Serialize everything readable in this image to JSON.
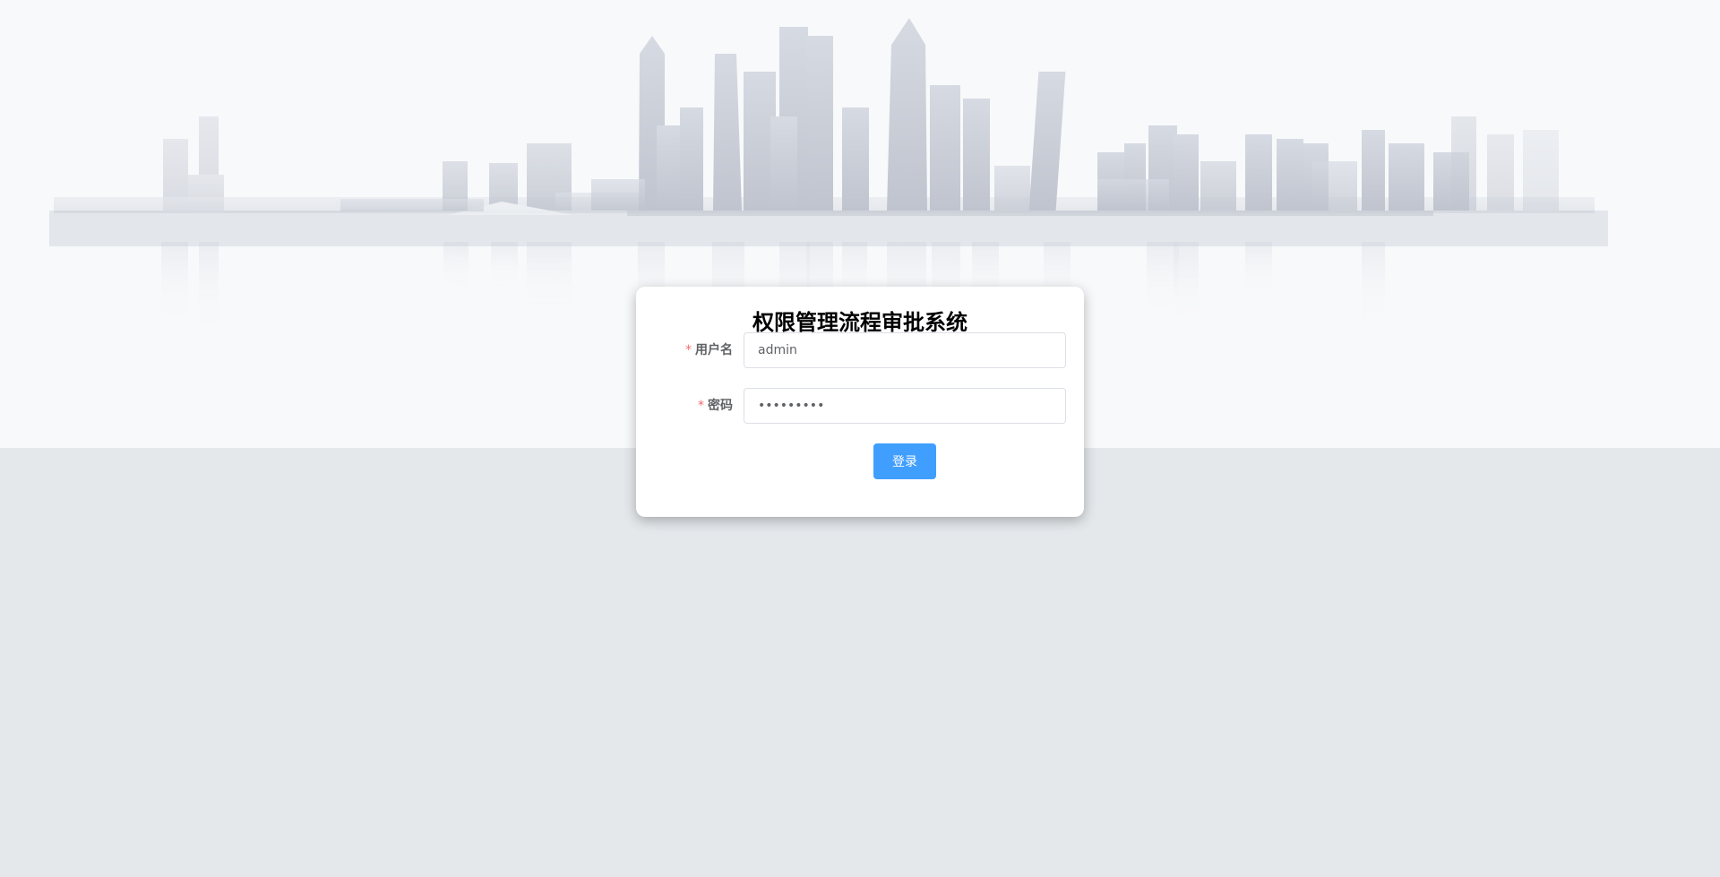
{
  "app": {
    "title": "权限管理流程审批系统"
  },
  "form": {
    "username": {
      "label": "用户名",
      "required_mark": "*",
      "value": "admin"
    },
    "password": {
      "label": "密码",
      "required_mark": "*",
      "value": "123456789"
    },
    "submit_label": "登录"
  },
  "colors": {
    "page_background": "#e4e8eb",
    "hero_background": "#f8f9fb",
    "primary_button": "#409eff",
    "required_mark": "#f56c6c"
  },
  "icons": [
    "city-skyline-background"
  ]
}
